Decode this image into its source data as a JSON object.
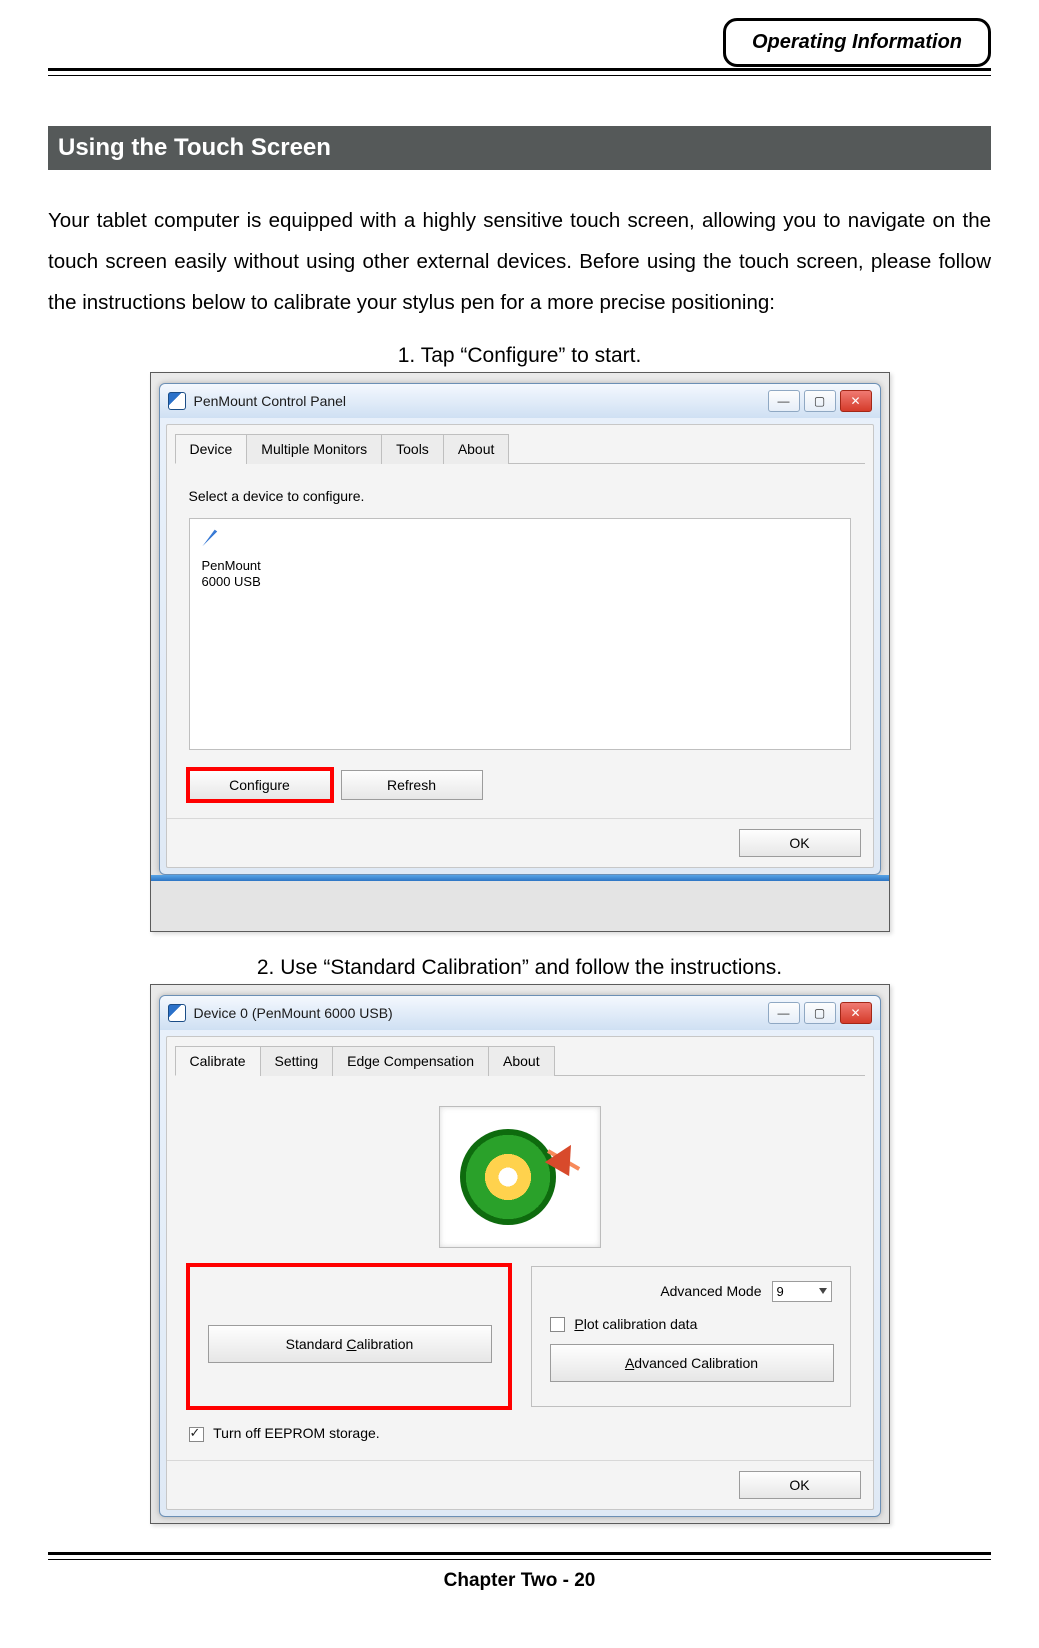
{
  "header": {
    "badge": "Operating Information"
  },
  "section": {
    "title": "Using the Touch Screen"
  },
  "intro": "Your tablet computer is equipped with a highly sensitive touch screen, allowing you to navigate on the touch screen easily without using other external devices. Before using the touch screen, please follow the instructions below to calibrate your stylus pen for a more precise positioning:",
  "steps": {
    "one": "1. Tap “Configure” to start.",
    "two": "2. Use “Standard Calibration” and follow the instructions."
  },
  "win1": {
    "title": "PenMount Control Panel",
    "tabs": [
      "Device",
      "Multiple Monitors",
      "Tools",
      "About"
    ],
    "instruction": "Select a device to configure.",
    "device_name_line1": "PenMount",
    "device_name_line2": "6000 USB",
    "buttons": {
      "configure": "Configure",
      "refresh": "Refresh",
      "ok": "OK"
    },
    "win_controls": {
      "min": "—",
      "max": "▢",
      "close": "✕"
    }
  },
  "win2": {
    "title": "Device 0 (PenMount 6000 USB)",
    "tabs": [
      "Calibrate",
      "Setting",
      "Edge Compensation",
      "About"
    ],
    "adv_mode_label": "Advanced Mode",
    "adv_mode_value": "9",
    "plot_label": "Plot calibration data",
    "plot_checked": false,
    "std_btn": {
      "pre": "Standard ",
      "u": "C",
      "post": "alibration"
    },
    "adv_btn": {
      "u": "A",
      "post": "dvanced Calibration"
    },
    "eeprom_label": "Turn off EEPROM storage.",
    "eeprom_checked": true,
    "ok": "OK",
    "win_controls": {
      "min": "—",
      "max": "▢",
      "close": "✕"
    }
  },
  "footer": "Chapter Two - 20"
}
